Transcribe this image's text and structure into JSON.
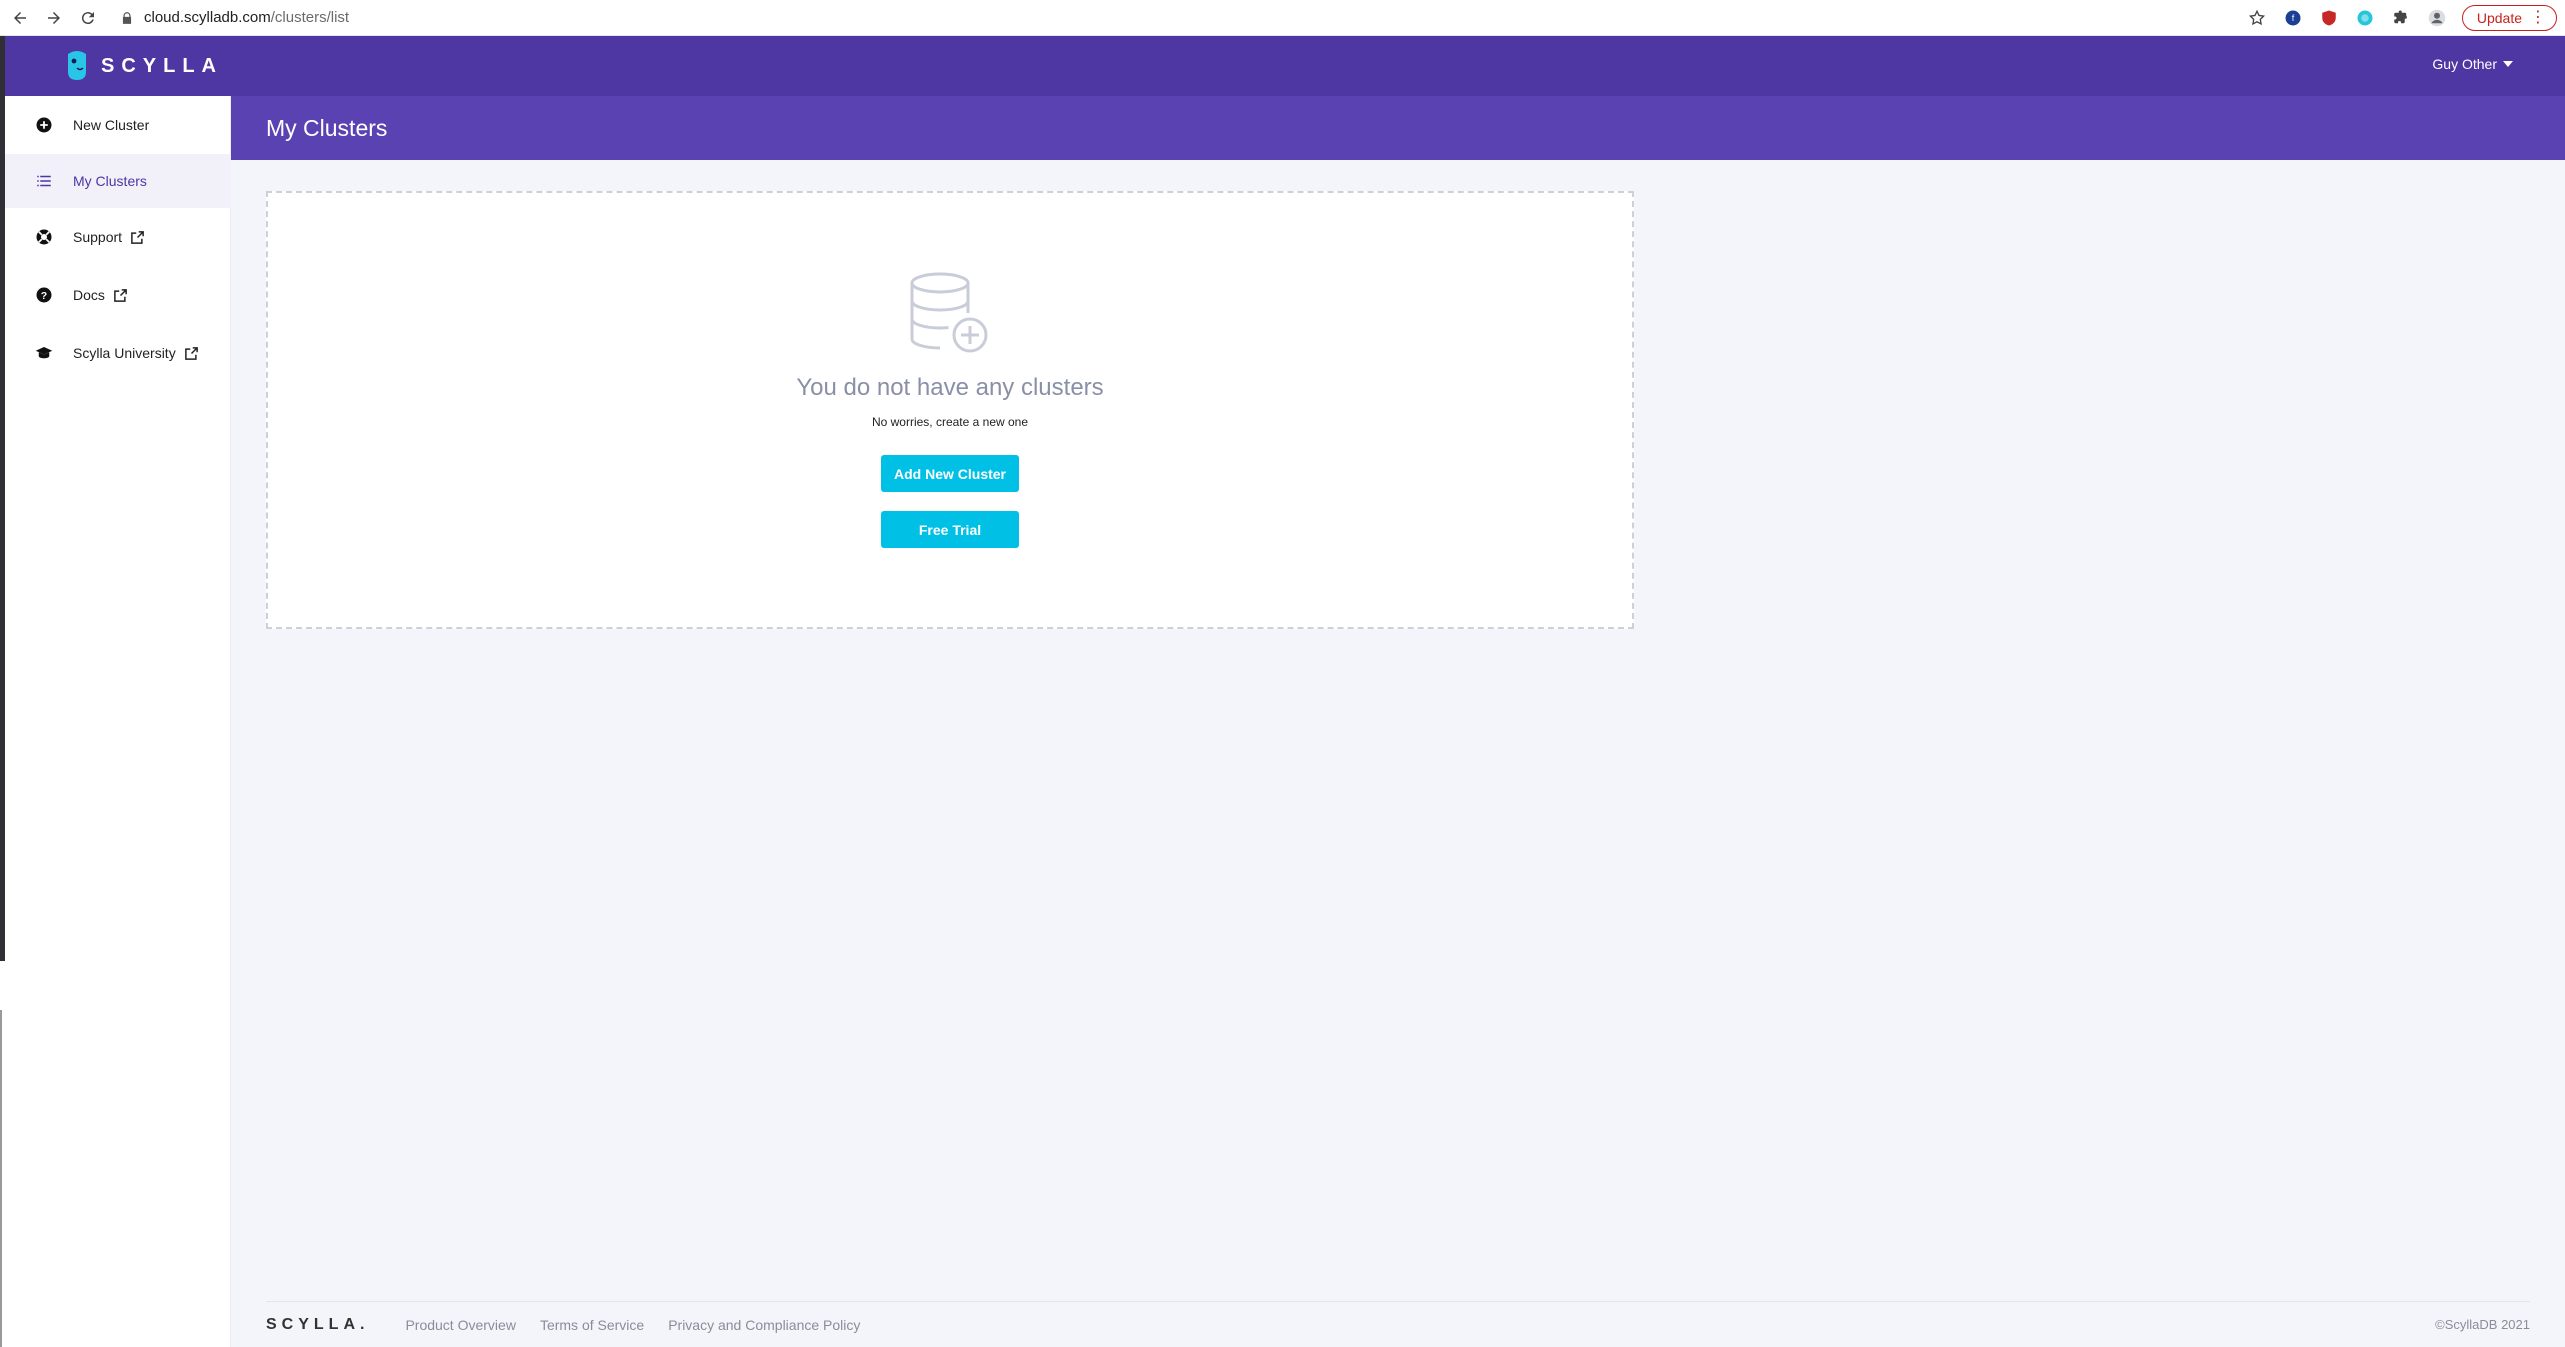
{
  "browser": {
    "url_host": "cloud.scylladb.com",
    "url_path": "/clusters/list",
    "update_label": "Update"
  },
  "header": {
    "logo_text": "SCYLLA",
    "user_name": "Guy Other"
  },
  "sidebar": {
    "items": [
      {
        "label": "New Cluster",
        "icon": "plus-circle-icon"
      },
      {
        "label": "My Clusters",
        "icon": "list-icon"
      },
      {
        "label": "Support",
        "icon": "lifebuoy-icon"
      },
      {
        "label": "Docs",
        "icon": "question-circle-icon"
      },
      {
        "label": "Scylla University",
        "icon": "graduation-cap-icon"
      }
    ]
  },
  "main": {
    "title": "My Clusters",
    "empty_state": {
      "icon": "database-add-icon",
      "title": "You do not have any clusters",
      "subtitle": "No worries, create a new one",
      "add_button": "Add New Cluster",
      "trial_button": "Free Trial"
    }
  },
  "footer": {
    "logo_text": "SCYLLA.",
    "links": [
      "Product Overview",
      "Terms of Service",
      "Privacy and Compliance Policy"
    ],
    "copyright": "©ScyllaDB 2021"
  },
  "colors": {
    "header_bg": "#4e36a3",
    "page_header_bg": "#5b42b3",
    "accent": "#00c1e5",
    "main_bg": "#f4f5fb"
  }
}
